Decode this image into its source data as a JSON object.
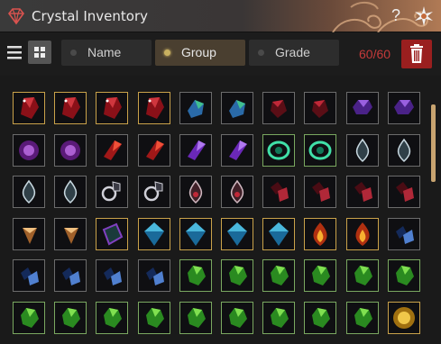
{
  "window": {
    "title": "Crystal Inventory",
    "help_label": "?"
  },
  "toolbar": {
    "sort_buttons": [
      {
        "label": "Name",
        "active": false
      },
      {
        "label": "Group",
        "active": true
      },
      {
        "label": "Grade",
        "active": false
      }
    ],
    "capacity": "60/60"
  },
  "colors": {
    "capacity_full": "#c53a3a",
    "active_sort": "#4a3f30",
    "trash": "#9a1f1f"
  },
  "inventory": {
    "rows": [
      [
        "red-crystal",
        "red-crystal",
        "red-crystal",
        "red-crystal",
        "blue-green-crystal",
        "blue-green-crystal",
        "dark-red-gem",
        "dark-red-gem",
        "purple-gem",
        "purple-gem"
      ],
      [
        "purple-orb",
        "purple-orb",
        "red-shard",
        "red-shard",
        "violet-shard",
        "violet-shard",
        "teal-orb",
        "teal-orb",
        "clear-drop",
        "clear-drop"
      ],
      [
        "clear-drop",
        "clear-drop",
        "silver-ring-gem",
        "silver-ring-gem",
        "clear-red-drop",
        "clear-red-drop",
        "dark-red-cluster",
        "dark-red-cluster",
        "dark-red-cluster",
        "dark-red-cluster"
      ],
      [
        "amber-cone",
        "amber-cone",
        "prism-crystal",
        "cyan-diamond",
        "cyan-diamond",
        "cyan-diamond",
        "cyan-diamond",
        "fire-drop",
        "fire-drop",
        "navy-cluster"
      ],
      [
        "navy-cluster",
        "navy-cluster",
        "navy-cluster",
        "navy-cluster",
        "green-gem",
        "green-gem",
        "green-gem",
        "green-gem",
        "green-gem",
        "green-gem"
      ],
      [
        "green-gem",
        "green-gem",
        "green-gem",
        "green-gem",
        "green-gem",
        "green-gem",
        "green-gem",
        "green-gem",
        "green-gem",
        "gold-orb"
      ]
    ]
  }
}
